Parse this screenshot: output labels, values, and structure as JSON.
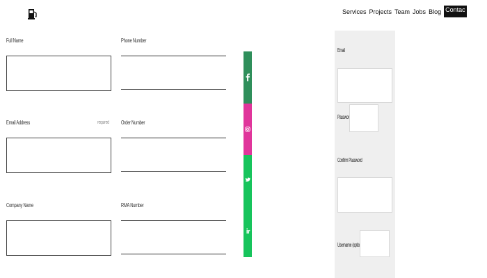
{
  "header": {
    "logo_icon": "fuel-pump-icon",
    "nav": [
      "Services",
      "Projects",
      "Team",
      "Jobs",
      "Blog",
      "Contac"
    ],
    "active_index": 5
  },
  "form": {
    "full_name_label": "Full Name",
    "phone_label": "Phone Number",
    "email_label": "Email Address",
    "email_required": "required",
    "order_label": "Order Number",
    "company_label": "Company Name",
    "rma_label": "RMA Number"
  },
  "social": [
    {
      "icon": "facebook-icon",
      "color": "#2f8f5b"
    },
    {
      "icon": "instagram-icon",
      "color": "#e0359b"
    },
    {
      "icon": "twitter-icon",
      "color": "#17c45c"
    },
    {
      "icon": "linkedin-icon",
      "color": "#17c45c"
    }
  ],
  "panel": {
    "email_label": "Email",
    "password_label": "Password",
    "confirm_label": "Confirm Password",
    "username_label": "Username (optional)"
  }
}
